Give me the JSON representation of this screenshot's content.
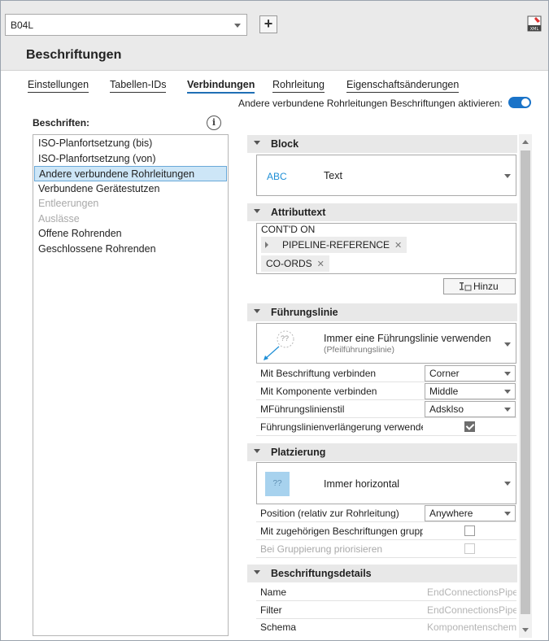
{
  "toolbar": {
    "combo_value": "B04L",
    "add_icon": "plus-icon",
    "export_icon": "xml-export-icon"
  },
  "page": {
    "title": "Beschriftungen"
  },
  "tabs": [
    {
      "label": "Einstellungen"
    },
    {
      "label": "Tabellen-IDs"
    },
    {
      "label": "Verbindungen",
      "active": true
    },
    {
      "label": "Rohrleitung"
    },
    {
      "label": "Eigenschaftsänderungen"
    }
  ],
  "enable": {
    "label": "Andere verbundene Rohrleitungen Beschriftungen aktivieren:",
    "on": true
  },
  "list": {
    "label": "Beschriften:",
    "items": [
      {
        "label": "ISO-Planfortsetzung (bis)"
      },
      {
        "label": "ISO-Planfortsetzung (von)"
      },
      {
        "label": "Andere verbundene Rohrleitungen",
        "selected": true
      },
      {
        "label": "Verbundene Gerätestutzen"
      },
      {
        "label": "Entleerungen",
        "disabled": true
      },
      {
        "label": "Auslässe",
        "disabled": true
      },
      {
        "label": "Offene Rohrenden"
      },
      {
        "label": "Geschlossene Rohrenden"
      }
    ]
  },
  "block": {
    "title": "Block",
    "preview": "ABC",
    "value": "Text"
  },
  "attr": {
    "title": "Attributtext",
    "line1": "CONT'D ON",
    "chip1": "PIPELINE-REFERENCE",
    "chip2": "CO-ORDS",
    "add_label": "Hinzu"
  },
  "leader": {
    "title": "Führungslinie",
    "preview": "??",
    "value": "Immer eine Führungslinie verwenden",
    "sub": "(Pfeilführungslinie)",
    "rows": [
      {
        "label": "Mit Beschriftung verbinden",
        "value": "Corner"
      },
      {
        "label": "Mit Komponente verbinden",
        "value": "Middle"
      },
      {
        "label": "MFührungslinienstil",
        "value": "Adsklso"
      }
    ],
    "ext_label": "Führungslinienverlängerung verwenden",
    "ext_checked": true
  },
  "placement": {
    "title": "Platzierung",
    "preview": "??",
    "value": "Immer horizontal",
    "pos_label": "Position (relativ zur Rohrleitung)",
    "pos_value": "Anywhere",
    "group_label": "Mit zugehörigen Beschriftungen gruppieren",
    "prio_label": "Bei Gruppierung priorisieren"
  },
  "details": {
    "title": "Beschriftungsdetails",
    "rows": [
      {
        "label": "Name",
        "value": "EndConnectionsPipe"
      },
      {
        "label": "Filter",
        "value": "EndConnectionsPipe"
      },
      {
        "label": "Schema",
        "value": "Komponentenschema"
      }
    ]
  }
}
